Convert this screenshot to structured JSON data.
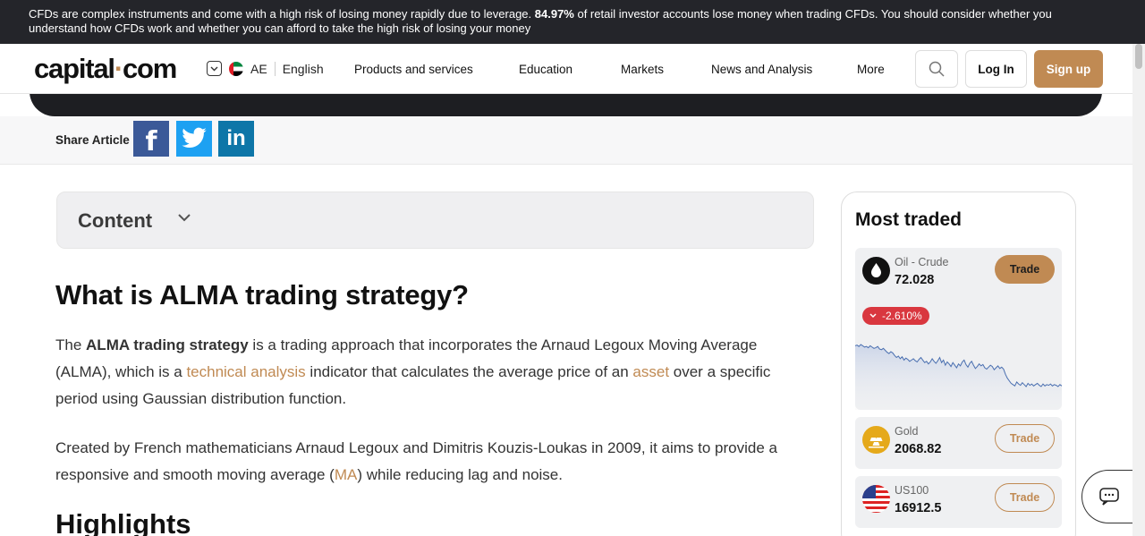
{
  "risk_warning": {
    "part1": "CFDs are complex instruments and come with a high risk of losing money rapidly due to leverage. ",
    "percent": "84.97%",
    "part2": " of retail investor accounts lose money when trading CFDs. You should consider whether you understand how CFDs work and whether you can afford to take the high risk of losing your money"
  },
  "header": {
    "logo_part1": "capital",
    "logo_dot": "·",
    "logo_part2": "com",
    "region": "AE",
    "language": "English",
    "nav": [
      "Products and services",
      "Education",
      "Markets",
      "News and Analysis",
      "More"
    ],
    "login_label": "Log In",
    "signup_label": "Sign up"
  },
  "share": {
    "label": "Share Article",
    "facebook": "f",
    "linkedin": "in"
  },
  "content_toggle": {
    "label": "Content"
  },
  "article": {
    "title": "What is ALMA trading strategy?",
    "p1": {
      "t1": "The ",
      "bold": "ALMA trading strategy",
      "t2": " is a trading approach that incorporates the Arnaud Legoux Moving Average (ALMA), which is a ",
      "link1": "technical analysis",
      "t3": " indicator that calculates the average price of an ",
      "link2": "asset",
      "t4": " over a specific period using Gaussian distribution function."
    },
    "p2": {
      "t1": "Created by French mathematicians Arnaud Legoux and Dimitris Kouzis-Loukas in 2009, it aims to provide a responsive and smooth moving average (",
      "link": "MA",
      "t2": ") while reducing lag and noise."
    },
    "next_heading": "Highlights"
  },
  "most_traded": {
    "title": "Most traded",
    "trade_label": "Trade",
    "items": [
      {
        "name": "Oil - Crude",
        "price": "72.028",
        "change": "-2.610%",
        "change_color": "#d9373f",
        "sparkline": [
          40,
          41,
          39,
          42,
          40,
          38,
          39,
          37,
          40,
          38,
          36,
          37,
          39,
          35,
          34,
          36,
          33,
          30,
          28,
          31,
          29,
          25,
          22,
          24,
          20,
          23,
          18,
          21,
          19,
          16,
          18,
          20,
          17,
          15,
          19,
          22,
          18,
          14,
          16,
          12,
          15,
          20,
          16,
          13,
          17,
          22,
          14,
          18,
          10,
          15,
          12,
          8,
          14,
          10,
          6,
          12,
          9,
          15,
          18,
          11,
          7,
          13,
          16,
          10,
          5,
          8,
          12,
          9,
          11,
          6,
          4,
          7,
          10,
          8,
          3,
          6,
          9,
          5,
          7,
          4,
          -4,
          -10,
          -14,
          -18,
          -20,
          -22,
          -16,
          -19,
          -21,
          -17,
          -20,
          -23,
          -18,
          -21,
          -19,
          -22,
          -20,
          -18,
          -21,
          -23,
          -19,
          -22,
          -20,
          -21,
          -19,
          -22,
          -20,
          -21,
          -23,
          -20,
          -22
        ]
      },
      {
        "name": "Gold",
        "price": "2068.82"
      },
      {
        "name": "US100",
        "price": "16912.5"
      }
    ]
  },
  "colors": {
    "accent": "#c08a53",
    "dark": "#1d1e22",
    "negative": "#d9373f"
  },
  "icons": [
    "chevron-down-icon",
    "uae-flag-icon",
    "search-icon",
    "facebook-icon",
    "twitter-icon",
    "linkedin-icon",
    "oil-drop-icon",
    "gold-bars-icon",
    "us-flag-icon",
    "chat-icon"
  ]
}
